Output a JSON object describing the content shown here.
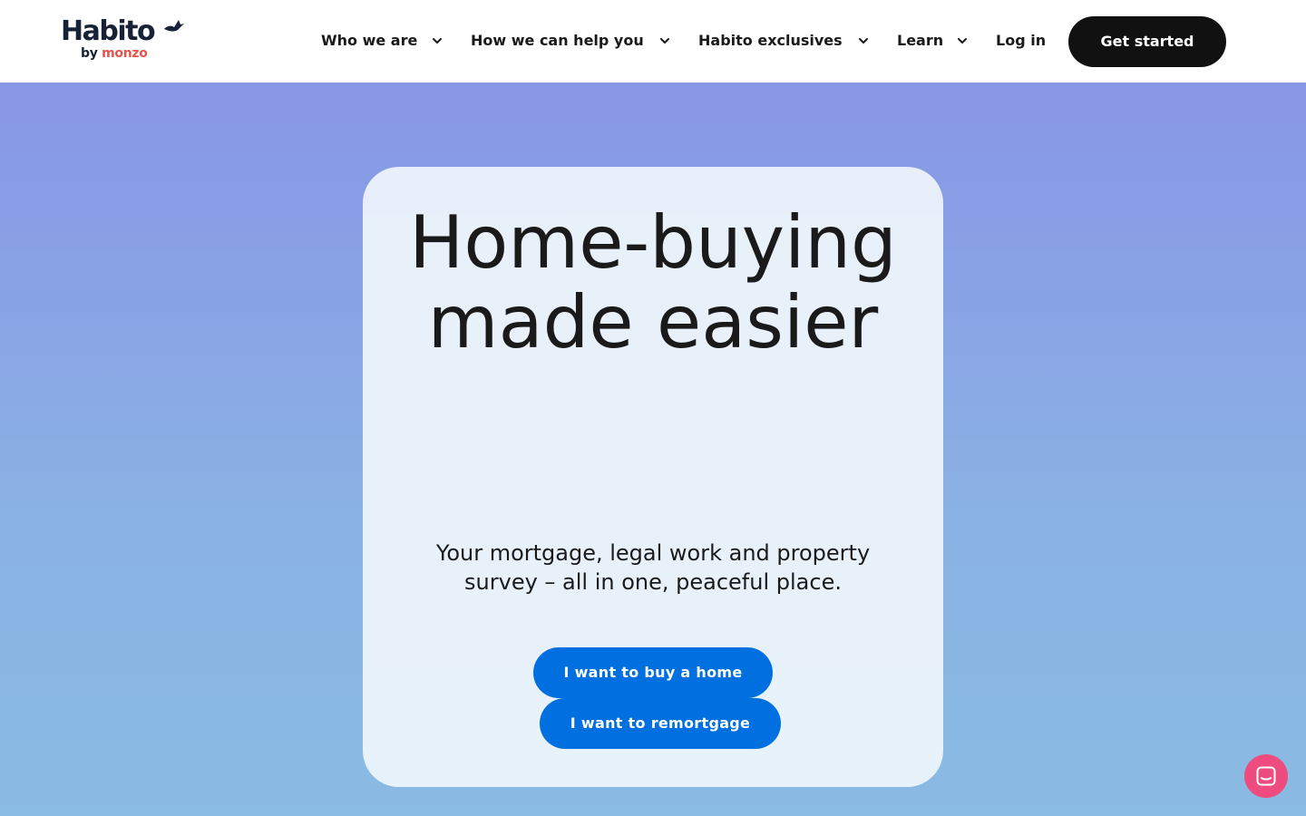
{
  "header": {
    "logo": {
      "name": "Habito",
      "sub_prefix": "by",
      "sub_brand": "monzo",
      "icon": "bird-icon"
    },
    "nav": [
      {
        "label": "Who we are",
        "icon": "chevron-down-icon"
      },
      {
        "label": "How we can help you",
        "icon": "chevron-down-icon"
      },
      {
        "label": "Habito exclusives",
        "icon": "chevron-down-icon"
      },
      {
        "label": "Learn",
        "icon": "chevron-down-icon"
      }
    ],
    "login_label": "Log in",
    "cta_label": "Get started"
  },
  "hero": {
    "title": "Home-buying made easier",
    "subtitle": "Your mortgage, legal work and property survey – all in one, peaceful place.",
    "buttons": {
      "buy": "I want to buy a home",
      "remortgage": "I want to remortgage"
    }
  },
  "chat": {
    "icon": "chat-icon"
  },
  "colors": {
    "primary_blue": "#0070e0",
    "cta_black": "#111111",
    "chat_pink": "#ee4c7f",
    "logo_navy": "#172236",
    "monzo_red": "#e8534b",
    "hero_gradient_top": "#8896e6",
    "hero_gradient_bottom": "#8abbe4"
  }
}
